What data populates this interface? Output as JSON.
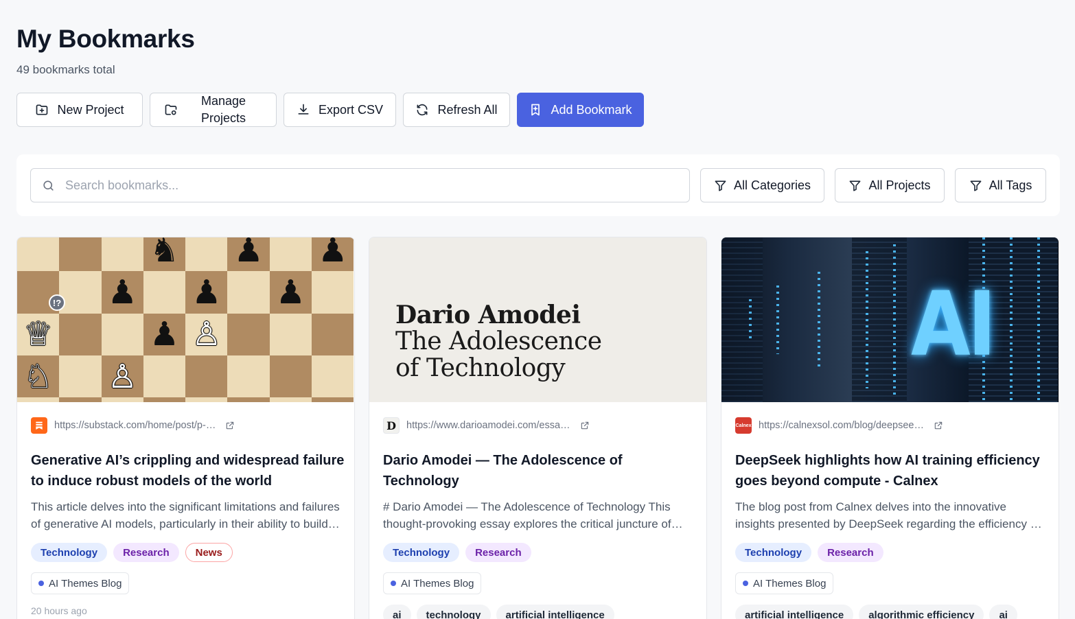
{
  "header": {
    "title": "My Bookmarks",
    "subtitle": "49 bookmarks total"
  },
  "toolbar": {
    "new_project": "New Project",
    "manage_projects_line1": "Manage",
    "manage_projects_line2": "Projects",
    "export_csv": "Export CSV",
    "refresh_all": "Refresh All",
    "add_bookmark": "Add Bookmark"
  },
  "filters": {
    "search_placeholder": "Search bookmarks...",
    "categories": "All Categories",
    "projects": "All Projects",
    "tags": "All Tags"
  },
  "colors": {
    "primary": "#4a62e0",
    "project_dot": "#4a62e0"
  },
  "bookmarks": [
    {
      "url": "https://substack.com/home/post/p-…",
      "favicon": "substack-bookmark-icon",
      "title": "Generative AI’s crippling and widespread failure to induce robust models of the world",
      "description": "This article delves into the significant limitations and failures of generative AI models, particularly in their ability to build robust models of the world.",
      "categories": [
        "Technology",
        "Research",
        "News"
      ],
      "project": "AI Themes Blog",
      "time": "20 hours ago"
    },
    {
      "url": "https://www.darioamodei.com/essa…",
      "favicon": "D",
      "image_text": {
        "name": "Dario Amodei",
        "line1": "The Adolescence",
        "line2": "of Technology"
      },
      "title": "Dario Amodei — The Adolescence of Technology",
      "description": "# Dario Amodei — The Adolescence of Technology This thought-provoking essay explores the critical juncture of technology.",
      "categories": [
        "Technology",
        "Research"
      ],
      "project": "AI Themes Blog",
      "tags": [
        "ai",
        "technology",
        "artificial intelligence"
      ]
    },
    {
      "url": "https://calnexsol.com/blog/deepsee…",
      "favicon": "Calnex",
      "image_text": "AI",
      "title": "DeepSeek highlights how AI training efficiency goes beyond compute - Calnex",
      "description": "The blog post from Calnex delves into the innovative insights presented by DeepSeek regarding the efficiency of AI training.",
      "categories": [
        "Technology",
        "Research"
      ],
      "project": "AI Themes Blog",
      "tags": [
        "artificial intelligence",
        "algorithmic efficiency",
        "ai"
      ]
    }
  ],
  "chess": {
    "rows": [
      [
        "",
        "",
        "",
        "♞",
        "",
        "♟",
        "",
        "♟"
      ],
      [
        "",
        "",
        "♟",
        "",
        "♟",
        "",
        "♟",
        ""
      ],
      [
        "♕",
        "",
        "",
        "♟",
        "♙",
        "",
        "",
        ""
      ],
      [
        "♘",
        "",
        "♙",
        "",
        "",
        "",
        "",
        ""
      ],
      [
        "♔",
        "♙",
        "",
        "♗",
        "",
        "",
        "",
        ""
      ]
    ],
    "annotation": "!?"
  }
}
